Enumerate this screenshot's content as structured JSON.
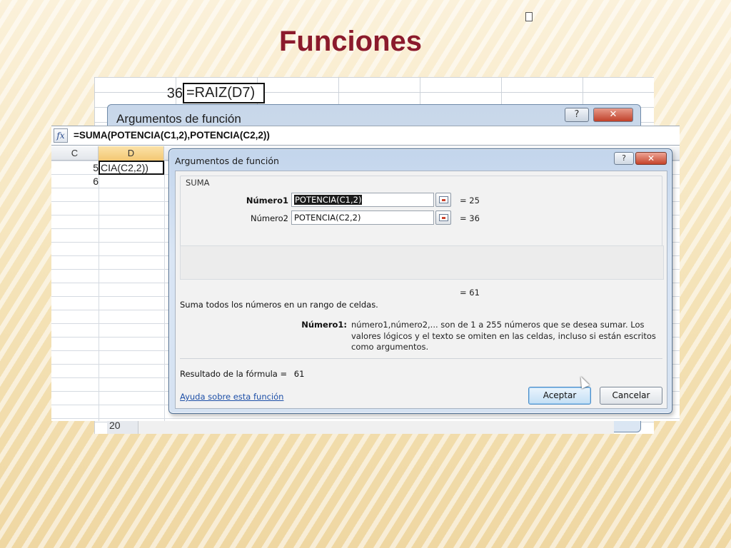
{
  "slide": {
    "title": "Funciones"
  },
  "back_screenshot": {
    "cell_value": "36",
    "cell_formula": "=RAIZ(D7)",
    "dialog_title": "Argumentos de función",
    "help_glyph": "?",
    "close_glyph": "✕",
    "row_number": "20"
  },
  "front_screenshot": {
    "formula_bar": {
      "fx_glyph": "fx",
      "formula": "=SUMA(POTENCIA(C1,2),POTENCIA(C2,2))"
    },
    "columns": [
      "C",
      "D"
    ],
    "cells": {
      "c1": "5",
      "c2": "6",
      "d1": "CIA(C2,2))"
    }
  },
  "dialog": {
    "title": "Argumentos de función",
    "help_glyph": "?",
    "close_glyph": "✕",
    "function_name": "SUMA",
    "arguments": [
      {
        "label": "Número1",
        "value": "POTENCIA(C1,2)",
        "result": "= 25"
      },
      {
        "label": "Número2",
        "value": "POTENCIA(C2,2)",
        "result": "= 36"
      }
    ],
    "total_result": "= 61",
    "description": "Suma todos los números en un rango de celdas.",
    "help_key": "Número1:",
    "help_text": "número1,número2,... son de 1 a 255 números que se desea sumar. Los valores lógicos y el texto se omiten en las celdas, incluso si están escritos como argumentos.",
    "formula_result_label": "Resultado de la fórmula =",
    "formula_result_value": "61",
    "help_link": "Ayuda sobre esta función",
    "ok_label": "Aceptar",
    "cancel_label": "Cancelar"
  }
}
